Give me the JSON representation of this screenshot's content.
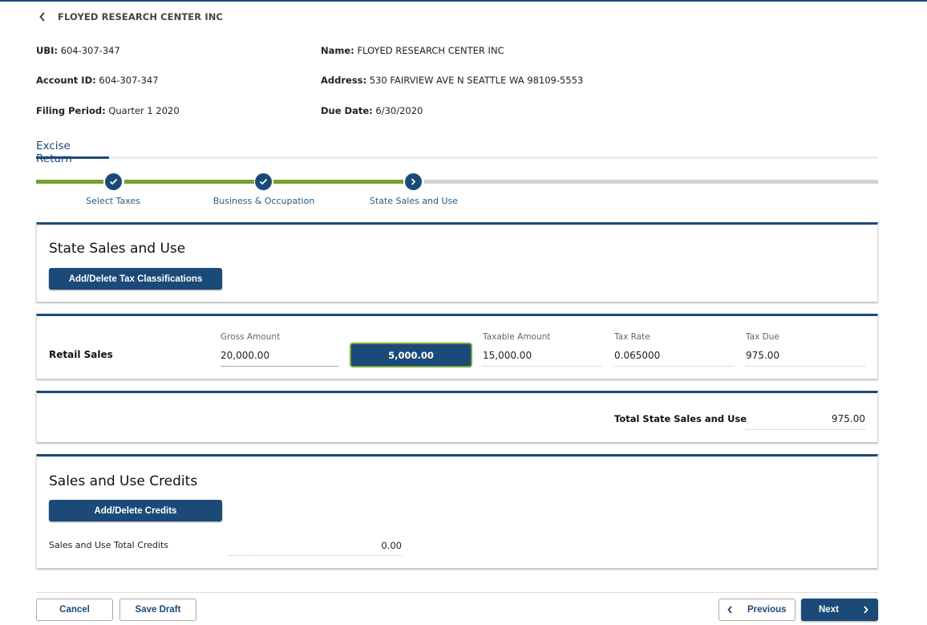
{
  "header": {
    "back_icon": "chevron-left-icon",
    "business_name": "FLOYED RESEARCH CENTER INC"
  },
  "info": {
    "ubi_label": "UBI:",
    "ubi_value": "604-307-347",
    "account_label": "Account ID:",
    "account_value": "604-307-347",
    "period_label": "Filing Period:",
    "period_value": "Quarter 1 2020",
    "name_label": "Name:",
    "name_value": "FLOYED RESEARCH CENTER INC",
    "address_label": "Address:",
    "address_value": "530 FAIRVIEW AVE N SEATTLE WA 98109-5553",
    "due_label": "Due Date:",
    "due_value": "6/30/2020"
  },
  "tabs": [
    {
      "label": "Excise Return",
      "active": true
    }
  ],
  "stepper": {
    "steps": [
      {
        "label": "Select Taxes",
        "state": "complete",
        "icon": "check-icon"
      },
      {
        "label": "Business & Occupation",
        "state": "complete",
        "icon": "check-icon"
      },
      {
        "label": "State Sales and Use",
        "state": "current",
        "icon": "chevron-right-icon"
      }
    ],
    "colors": {
      "complete": "#76a030",
      "pending": "#d3d3d3",
      "dot": "#1b4a78"
    }
  },
  "sales_section": {
    "title": "State Sales and Use",
    "button_label": "Add/Delete Tax Classifications"
  },
  "classification": {
    "name": "Retail Sales",
    "gross_label": "Gross Amount",
    "gross_value": "20,000.00",
    "deduction_value": "5,000.00",
    "taxable_label": "Taxable Amount",
    "taxable_value": "15,000.00",
    "rate_label": "Tax Rate",
    "rate_value": "0.065000",
    "due_label": "Tax Due",
    "due_value": "975.00"
  },
  "total": {
    "label": "Total State Sales and Use",
    "value": "975.00"
  },
  "credits_section": {
    "title": "Sales and Use Credits",
    "button_label": "Add/Delete Credits",
    "total_label": "Sales and Use Total Credits",
    "total_value": "0.00"
  },
  "footer": {
    "cancel_label": "Cancel",
    "save_label": "Save Draft",
    "previous_label": "Previous",
    "next_label": "Next"
  },
  "colors": {
    "brand": "#1b4a78",
    "accent_green": "#76a030"
  }
}
